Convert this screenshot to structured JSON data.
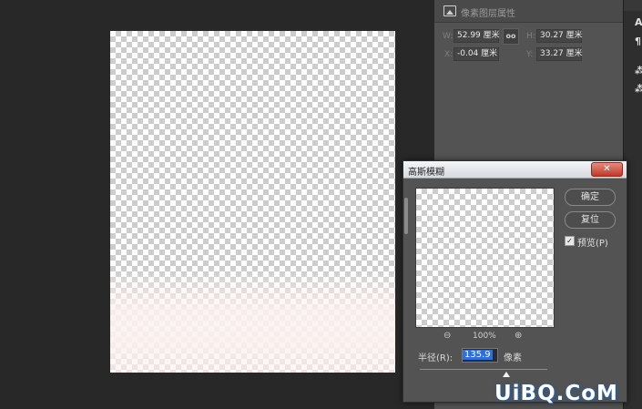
{
  "properties_panel": {
    "title": "像素图层属性",
    "w_label": "W:",
    "w_value": "52.99 厘米",
    "h_label": "H:",
    "h_value": "30.27 厘米",
    "x_label": "X:",
    "x_value": "-0.04 厘米",
    "y_label": "Y:",
    "y_value": "33.27 厘米",
    "link_icon": "link-icon"
  },
  "toolbar_strip": {
    "tools": [
      "A",
      "¶",
      "⁂",
      "⁂"
    ]
  },
  "dialog": {
    "title": "高斯模糊",
    "close_label": "✕",
    "ok_label": "确定",
    "reset_label": "复位",
    "preview_label": "预览(P)",
    "preview_checked": "✓",
    "zoom_out_icon": "⊖",
    "zoom_value": "100%",
    "zoom_in_icon": "⊕",
    "radius_label": "半径(R):",
    "radius_value": "135.9",
    "unit_label": "像素",
    "slider_value_fraction": 0.68
  },
  "watermark": "UiBQ.CoM",
  "colors": {
    "workspace": "#282828",
    "panel": "#535353",
    "selection": "#2f6fd6",
    "close": "#c0392b"
  }
}
